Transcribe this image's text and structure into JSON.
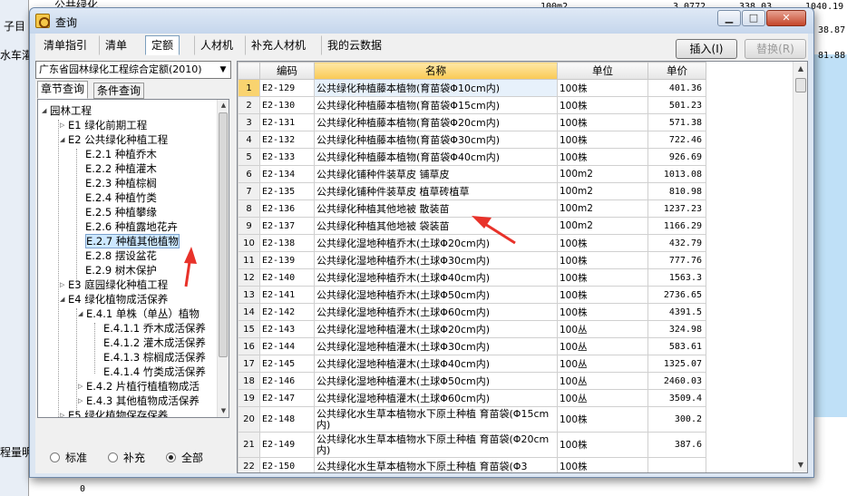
{
  "background": {
    "row1_text": "公共绿化",
    "row1_unit": "100m2",
    "row1_v1": "3.0772",
    "row1_v2": "338.03",
    "row1_v3": "1040.19",
    "left_label1": "子目",
    "left_label2": "水车灌",
    "left_label3": "程量明",
    "right_val1": "38.87",
    "right_val2": "81.88",
    "bottom_val": "0"
  },
  "window": {
    "title": "查询",
    "min_label": "▁",
    "max_label": "□",
    "close_label": "✕"
  },
  "toolbar": {
    "tabs": [
      "清单指引",
      "清单",
      "定额",
      "人材机",
      "补充人材机",
      "我的云数据"
    ],
    "active_tab": "定额",
    "insert_label": "插入(I)",
    "replace_label": "替换(R)"
  },
  "left_panel": {
    "quota_library": "广东省园林绿化工程综合定额(2010)",
    "subtabs": [
      "章节查询",
      "条件查询"
    ],
    "tree": [
      {
        "label": "园林工程",
        "level": 0,
        "expanded": true
      },
      {
        "label": "E1 绿化前期工程",
        "level": 1,
        "expanded": false
      },
      {
        "label": "E2 公共绿化种植工程",
        "level": 1,
        "expanded": true
      },
      {
        "label": "E.2.1 种植乔木",
        "level": 2
      },
      {
        "label": "E.2.2 种植灌木",
        "level": 2
      },
      {
        "label": "E.2.3 种植棕榈",
        "level": 2
      },
      {
        "label": "E.2.4 种植竹类",
        "level": 2
      },
      {
        "label": "E.2.5 种植攀缘",
        "level": 2
      },
      {
        "label": "E.2.6 种植露地花卉",
        "level": 2
      },
      {
        "label": "E.2.7 种植其他植物",
        "level": 2,
        "selected": true
      },
      {
        "label": "E.2.8 摆设盆花",
        "level": 2
      },
      {
        "label": "E.2.9 树木保护",
        "level": 2
      },
      {
        "label": "E3 庭园绿化种植工程",
        "level": 1,
        "expanded": false
      },
      {
        "label": "E4 绿化植物成活保养",
        "level": 1,
        "expanded": true
      },
      {
        "label": "E.4.1 单株（单丛）植物",
        "level": 2,
        "expanded": true
      },
      {
        "label": "E.4.1.1 乔木成活保养",
        "level": 3
      },
      {
        "label": "E.4.1.2 灌木成活保养",
        "level": 3
      },
      {
        "label": "E.4.1.3 棕榈成活保养",
        "level": 3
      },
      {
        "label": "E.4.1.4 竹类成活保养",
        "level": 3
      },
      {
        "label": "E.4.2 片植行植植物成活",
        "level": 2,
        "expanded": false
      },
      {
        "label": "E.4.3 其他植物成活保养",
        "level": 2,
        "expanded": false
      },
      {
        "label": "E5 绿化植物保存保养",
        "level": 1,
        "expanded": false
      }
    ],
    "filter_options": [
      "标准",
      "补充",
      "全部"
    ],
    "filter_selected": "全部"
  },
  "grid": {
    "headers": [
      "",
      "编码",
      "名称",
      "单位",
      "单价"
    ],
    "selected_row": 1,
    "rows": [
      [
        "1",
        "E2-129",
        "公共绿化种植藤本植物(育苗袋Φ10cm内)",
        "100株",
        "401.36"
      ],
      [
        "2",
        "E2-130",
        "公共绿化种植藤本植物(育苗袋Φ15cm内)",
        "100株",
        "501.23"
      ],
      [
        "3",
        "E2-131",
        "公共绿化种植藤本植物(育苗袋Φ20cm内)",
        "100株",
        "571.38"
      ],
      [
        "4",
        "E2-132",
        "公共绿化种植藤本植物(育苗袋Φ30cm内)",
        "100株",
        "722.46"
      ],
      [
        "5",
        "E2-133",
        "公共绿化种植藤本植物(育苗袋Φ40cm内)",
        "100株",
        "926.69"
      ],
      [
        "6",
        "E2-134",
        "公共绿化铺种件装草皮 铺草皮",
        "100m2",
        "1013.08"
      ],
      [
        "7",
        "E2-135",
        "公共绿化铺种件装草皮 植草砖植草",
        "100m2",
        "810.98"
      ],
      [
        "8",
        "E2-136",
        "公共绿化种植其他地被 散装苗",
        "100m2",
        "1237.23"
      ],
      [
        "9",
        "E2-137",
        "公共绿化种植其他地被 袋装苗",
        "100m2",
        "1166.29"
      ],
      [
        "10",
        "E2-138",
        "公共绿化湿地种植乔木(土球Φ20cm内)",
        "100株",
        "432.79"
      ],
      [
        "11",
        "E2-139",
        "公共绿化湿地种植乔木(土球Φ30cm内)",
        "100株",
        "777.76"
      ],
      [
        "12",
        "E2-140",
        "公共绿化湿地种植乔木(土球Φ40cm内)",
        "100株",
        "1563.3"
      ],
      [
        "13",
        "E2-141",
        "公共绿化湿地种植乔木(土球Φ50cm内)",
        "100株",
        "2736.65"
      ],
      [
        "14",
        "E2-142",
        "公共绿化湿地种植乔木(土球Φ60cm内)",
        "100株",
        "4391.5"
      ],
      [
        "15",
        "E2-143",
        "公共绿化湿地种植灌木(土球Φ20cm内)",
        "100丛",
        "324.98"
      ],
      [
        "16",
        "E2-144",
        "公共绿化湿地种植灌木(土球Φ30cm内)",
        "100丛",
        "583.61"
      ],
      [
        "17",
        "E2-145",
        "公共绿化湿地种植灌木(土球Φ40cm内)",
        "100丛",
        "1325.07"
      ],
      [
        "18",
        "E2-146",
        "公共绿化湿地种植灌木(土球Φ50cm内)",
        "100丛",
        "2460.03"
      ],
      [
        "19",
        "E2-147",
        "公共绿化湿地种植灌木(土球Φ60cm内)",
        "100丛",
        "3509.4"
      ],
      [
        "20",
        "E2-148",
        "公共绿化水生草本植物水下原土种植 育苗袋(Φ15cm内)",
        "100株",
        "300.2"
      ],
      [
        "21",
        "E2-149",
        "公共绿化水生草本植物水下原土种植 育苗袋(Φ20cm内)",
        "100株",
        "387.6"
      ],
      [
        "22",
        "E2-150",
        "公共绿化水生草本植物水下原土种植 育苗袋(Φ3",
        "100株",
        ""
      ]
    ]
  },
  "colors": {
    "selected_header": "#f9c953",
    "annotation_arrow": "#e8322a"
  }
}
